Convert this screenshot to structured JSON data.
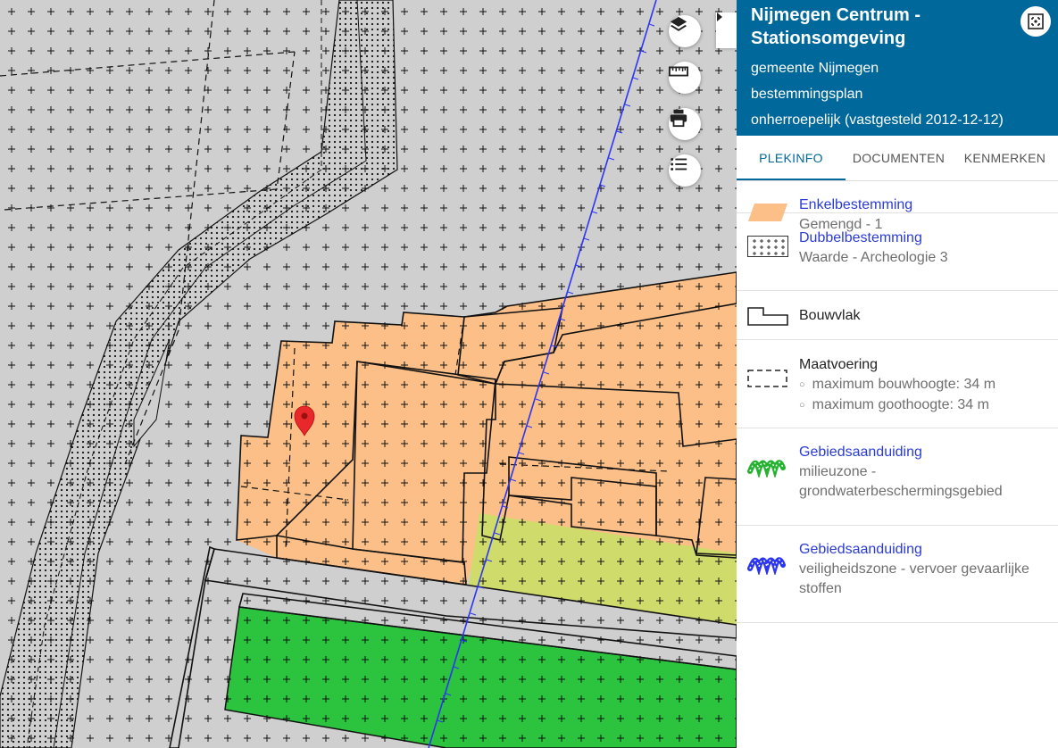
{
  "plan": {
    "title": "Nijmegen Centrum - Stationsomgeving",
    "municipality": "gemeente Nijmegen",
    "type": "bestemmingsplan",
    "status": "onherroepelijk (vastgesteld 2012-12-12)"
  },
  "tabs": [
    {
      "label": "PLEKINFO",
      "active": true
    },
    {
      "label": "DOCUMENTEN",
      "active": false
    },
    {
      "label": "KENMERKEN",
      "active": false
    }
  ],
  "legend": [
    {
      "title": "Enkelbestemming",
      "subtitle": "Gemengd - 1",
      "symbol": "orange-parallelogram"
    },
    {
      "title": "Dubbelbestemming",
      "subtitle": "Waarde - Archeologie 3",
      "symbol": "crosses-pattern"
    },
    {
      "title": "Bouwvlak",
      "symbol": "building-outline"
    },
    {
      "title": "Maatvoering",
      "items": [
        "maximum bouwhoogte: 34 m",
        "maximum goothoogte: 34 m"
      ],
      "symbol": "dashed-rect"
    },
    {
      "title": "Gebiedsaanduiding",
      "subtitle": "milieuzone - grondwaterbeschermingsgebied",
      "symbol": "green-zigzag"
    },
    {
      "title": "Gebiedsaanduiding",
      "subtitle": "veiligheidszone - vervoer gevaarlijke stoffen",
      "symbol": "blue-zigzag"
    }
  ],
  "map_controls": [
    "layers-icon",
    "ruler-icon",
    "print-icon",
    "legend-list-icon"
  ],
  "colors": {
    "header": "#01689b",
    "gemengd": "#fbbf87",
    "groen": "#2cc43f",
    "lightgreen": "#cfdb6b",
    "base": "#cfcfcf",
    "rail": "#2b35f2",
    "marker": "#e8282b"
  }
}
